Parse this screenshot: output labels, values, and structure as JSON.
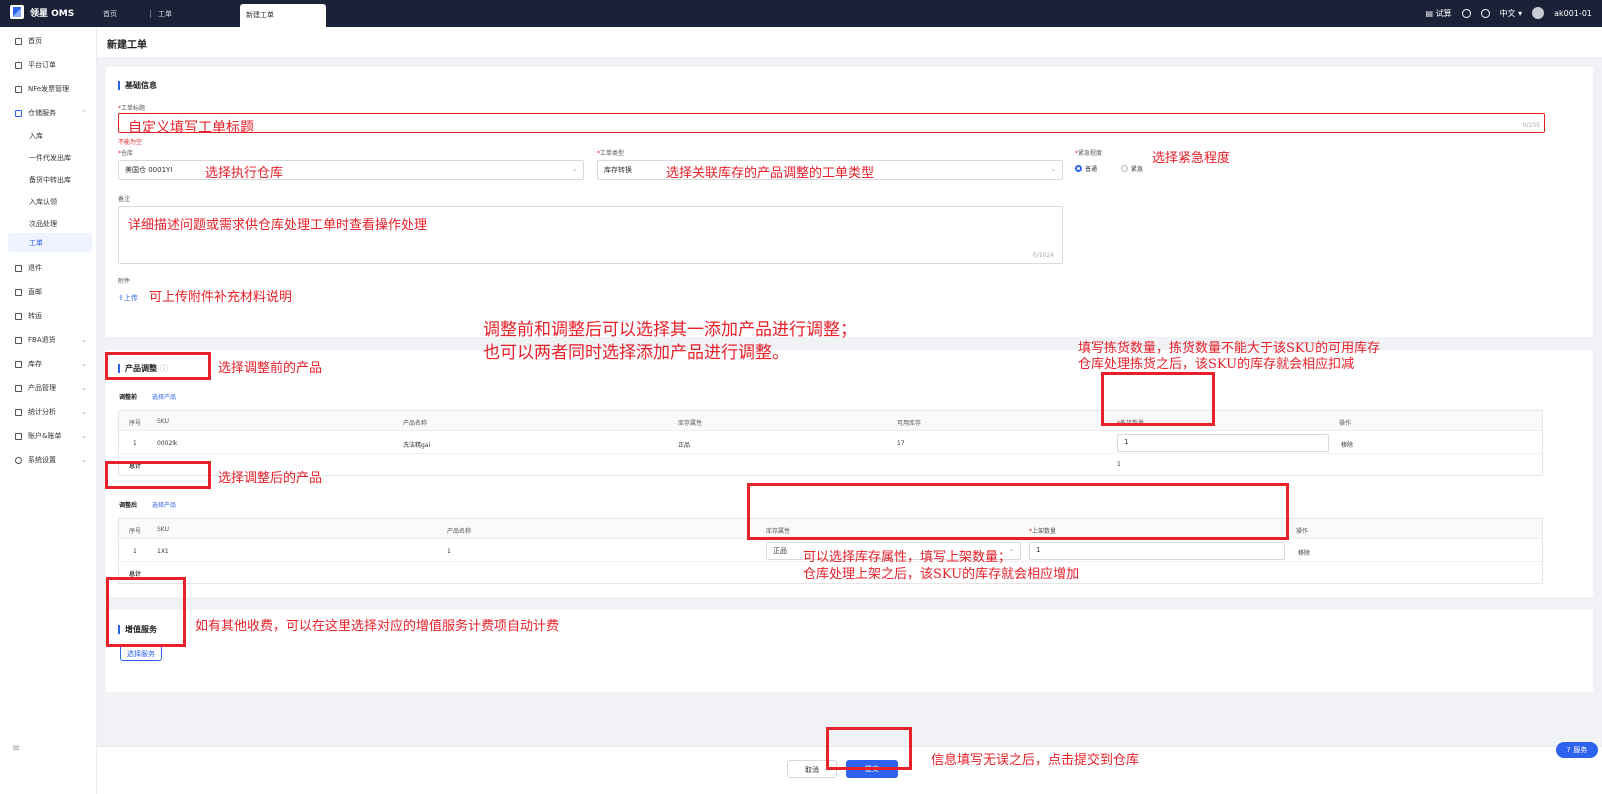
{
  "topbar": {
    "brand": "领星 OMS",
    "tabs": [
      "首页",
      "工单",
      "新建工单"
    ],
    "trial": "试算",
    "language": "中文",
    "user": "ak001-01"
  },
  "sidebar": {
    "items": [
      "首页",
      "平台订单",
      "NFe发票管理",
      "仓储服务",
      "退件",
      "直邮",
      "转运",
      "FBA退货",
      "库存",
      "产品管理",
      "统计分析",
      "账户&账单",
      "系统设置"
    ],
    "sub_items": [
      "入库",
      "一件代发出库",
      "备货中转出库",
      "入库认领",
      "次品处理",
      "工单"
    ]
  },
  "page": {
    "title": "新建工单"
  },
  "basic": {
    "section_title": "基础信息",
    "title_label": "工单标题",
    "title_value": "自定义填写工单标题",
    "title_counter": "0/255",
    "title_error": "不能为空",
    "warehouse_label": "仓库",
    "warehouse_value": "美国仓 0001YI",
    "type_label": "工单类型",
    "type_value": "库存转换",
    "urgency_label": "紧急程度",
    "urgency_normal": "普通",
    "urgency_urgent": "紧急",
    "remark_label": "备注",
    "remark_value": "详细描述问题或需求供仓库处理工单时查看操作处理",
    "remark_counter": "0/1024",
    "attach_label": "附件",
    "upload_label": "上传"
  },
  "adjust": {
    "section_title": "产品调整",
    "before_label": "调整前",
    "after_label": "调整后",
    "select_product": "选择产品",
    "before_headers": [
      "序号",
      "SKU",
      "产品名称",
      "库存属性",
      "可用库存",
      "拣货数量",
      "操作"
    ],
    "before_rows": [
      {
        "no": "1",
        "sku": "0002lk",
        "name": "洗洁精gai",
        "attr": "正品",
        "avail": "17",
        "qty": "1",
        "op": "移除"
      }
    ],
    "before_total_label": "总计",
    "before_total_value": "1",
    "after_headers": [
      "序号",
      "SKU",
      "产品名称",
      "库存属性",
      "上架数量",
      "操作"
    ],
    "after_rows": [
      {
        "no": "1",
        "sku": "1X1",
        "name": "1",
        "attr": "正品",
        "qty": "1",
        "op": "移除"
      }
    ],
    "after_total_label": "总计"
  },
  "vas": {
    "section_title": "增值服务",
    "select_service": "选择服务"
  },
  "footer": {
    "cancel": "取消",
    "submit": "提交"
  },
  "help": "服务",
  "annotations": {
    "title": "自定义填写工单标题",
    "warehouse": "选择执行仓库",
    "type": "选择关联库存的产品调整的工单类型",
    "urgency": "选择紧急程度",
    "remark": "详细描述问题或需求供仓库处理工单时查看操作处理",
    "attach": "可上传附件补充材料说明",
    "adjust_line1": "调整前和调整后可以选择其一添加产品进行调整；",
    "adjust_line2": "也可以两者同时选择添加产品进行调整。",
    "before": "选择调整前的产品",
    "pick_line1": "填写拣货数量，拣货数量不能大于该SKU的可用库存",
    "pick_line2": "仓库处理拣货之后，该SKU的库存就会相应扣减",
    "after": "选择调整后的产品",
    "shelf_line1": "可以选择库存属性，填写上架数量；",
    "shelf_line2": "仓库处理上架之后，该SKU的库存就会相应增加",
    "vas": "如有其他收费，可以在这里选择对应的增值服务计费项自动计费",
    "submit": "信息填写无误之后，点击提交到仓库"
  }
}
